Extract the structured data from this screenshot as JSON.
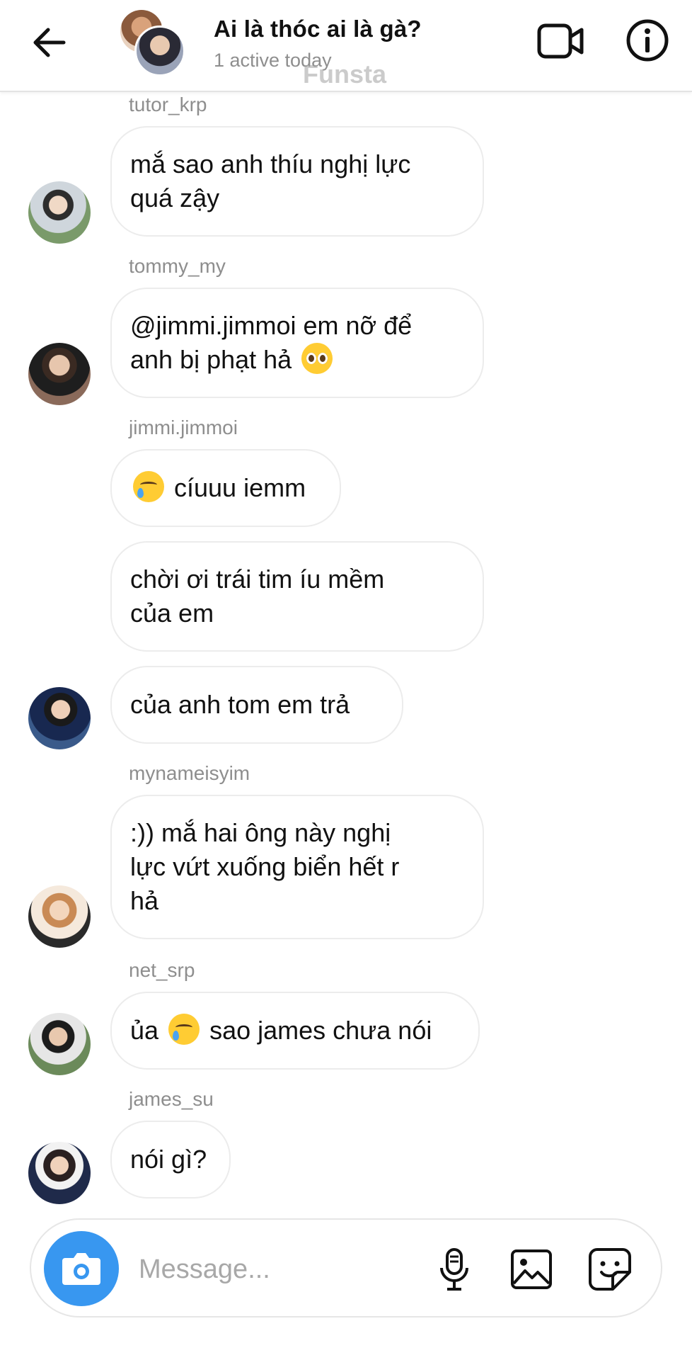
{
  "header": {
    "title": "Ai là thóc ai là gà?",
    "status": "1 active today",
    "watermark": "Funsta"
  },
  "messages": [
    {
      "sender": "tutor_krp",
      "text": "mắ sao anh thíu nghị lực\nquá zậy"
    },
    {
      "sender": "tommy_my",
      "text_before": "@jimmi.jimmoi em nỡ để\nanh bị phạt hả",
      "emoji": "pleading-face"
    },
    {
      "sender": "jimmi.jimmoi",
      "emoji": "smiling-face-with-tear",
      "text_after": "cíuuu iemm"
    },
    {
      "text": "chời ơi trái tim íu mềm\ncủa em"
    },
    {
      "text": "của anh tom em trả"
    },
    {
      "sender": "mynameisyim",
      "text": ":)) mắ hai ông này nghị\nlực vứt xuống biển hết r\nhả"
    },
    {
      "sender": "net_srp",
      "text_before": "ủa",
      "emoji": "smiling-face-with-tear",
      "text_after": "sao james chưa nói"
    },
    {
      "sender": "james_su",
      "text": "nói gì?"
    }
  ],
  "composer": {
    "placeholder": "Message..."
  },
  "colors": {
    "accent": "#3897f0",
    "bubble_border": "#ececec",
    "secondary_text": "#8e8e8e"
  }
}
